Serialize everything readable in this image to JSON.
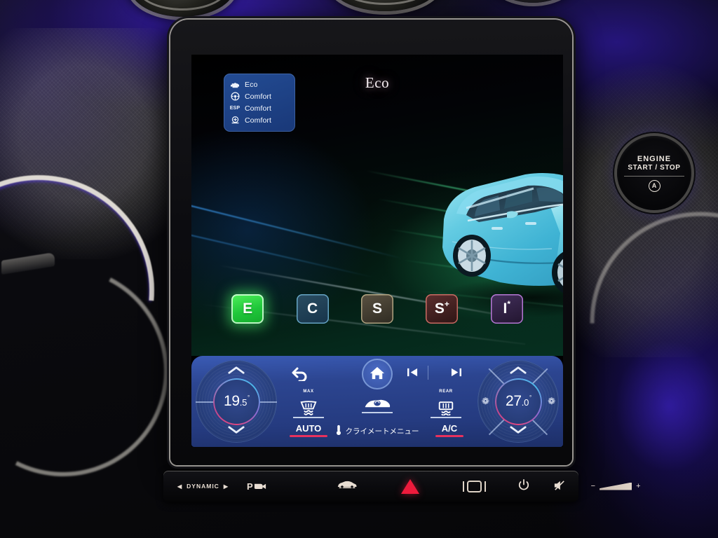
{
  "display": {
    "title": "Eco",
    "status_card": {
      "rows": [
        {
          "icon": "engine-icon",
          "label": "Eco"
        },
        {
          "icon": "steering-wheel-icon",
          "label": "Comfort"
        },
        {
          "icon": "esp-icon",
          "label": "Comfort"
        },
        {
          "icon": "suspension-icon",
          "label": "Comfort"
        }
      ]
    },
    "drive_modes": [
      {
        "id": "eco",
        "label": "E",
        "sup": "",
        "active": true
      },
      {
        "id": "comfort",
        "label": "C",
        "sup": "",
        "active": false
      },
      {
        "id": "sport",
        "label": "S",
        "sup": "",
        "active": false
      },
      {
        "id": "sportplus",
        "label": "S",
        "sup": "+",
        "active": false
      },
      {
        "id": "individual",
        "label": "I",
        "sup": "*",
        "active": false
      }
    ],
    "accent_colors": {
      "eco_green": "#2ecc40",
      "comfort_blue": "#6fbcdd",
      "sport_gold": "#cdbe96",
      "sportplus_red": "#e2786e",
      "individual_purple": "#c482e4",
      "highlight_red": "#e8315e"
    }
  },
  "climate": {
    "left_temp": {
      "whole": "19",
      "decimal": ".5",
      "degree": "°"
    },
    "right_temp": {
      "whole": "27",
      "decimal": ".0",
      "degree": "°"
    },
    "nav": {
      "back": "back-arrow-icon",
      "home": "home-icon",
      "prev": "previous-track-icon",
      "next": "next-track-icon"
    },
    "functions": [
      {
        "id": "front-defrost",
        "tag": "MAX",
        "icon": "front-defrost-icon"
      },
      {
        "id": "air-recirculation",
        "tag": "",
        "icon": "air-recirculation-icon"
      },
      {
        "id": "rear-defrost",
        "tag": "REAR",
        "icon": "rear-defrost-icon"
      }
    ],
    "labels": {
      "auto": "AUTO",
      "climate_menu": "クライメートメニュー",
      "ac": "A/C"
    },
    "chevrons": {
      "up": "⌃",
      "down": "⌄"
    },
    "fan": {
      "left": "❁",
      "right": "❁"
    }
  },
  "button_bar": {
    "dynamic": {
      "left_arrow": "◀",
      "label": "DYNAMIC",
      "right_arrow": "▶"
    },
    "park_camera": {
      "p": "P",
      "icon": "camera-icon"
    },
    "car": "vehicle-icon",
    "hazard": "hazard-triangle-icon",
    "window": "window-icon",
    "power": "⏻",
    "mute": "mute-icon",
    "volume": {
      "minus": "−",
      "plus": "+"
    }
  },
  "engine_button": {
    "line1": "ENGINE",
    "line2": "START / STOP",
    "eco_badge": "A"
  }
}
